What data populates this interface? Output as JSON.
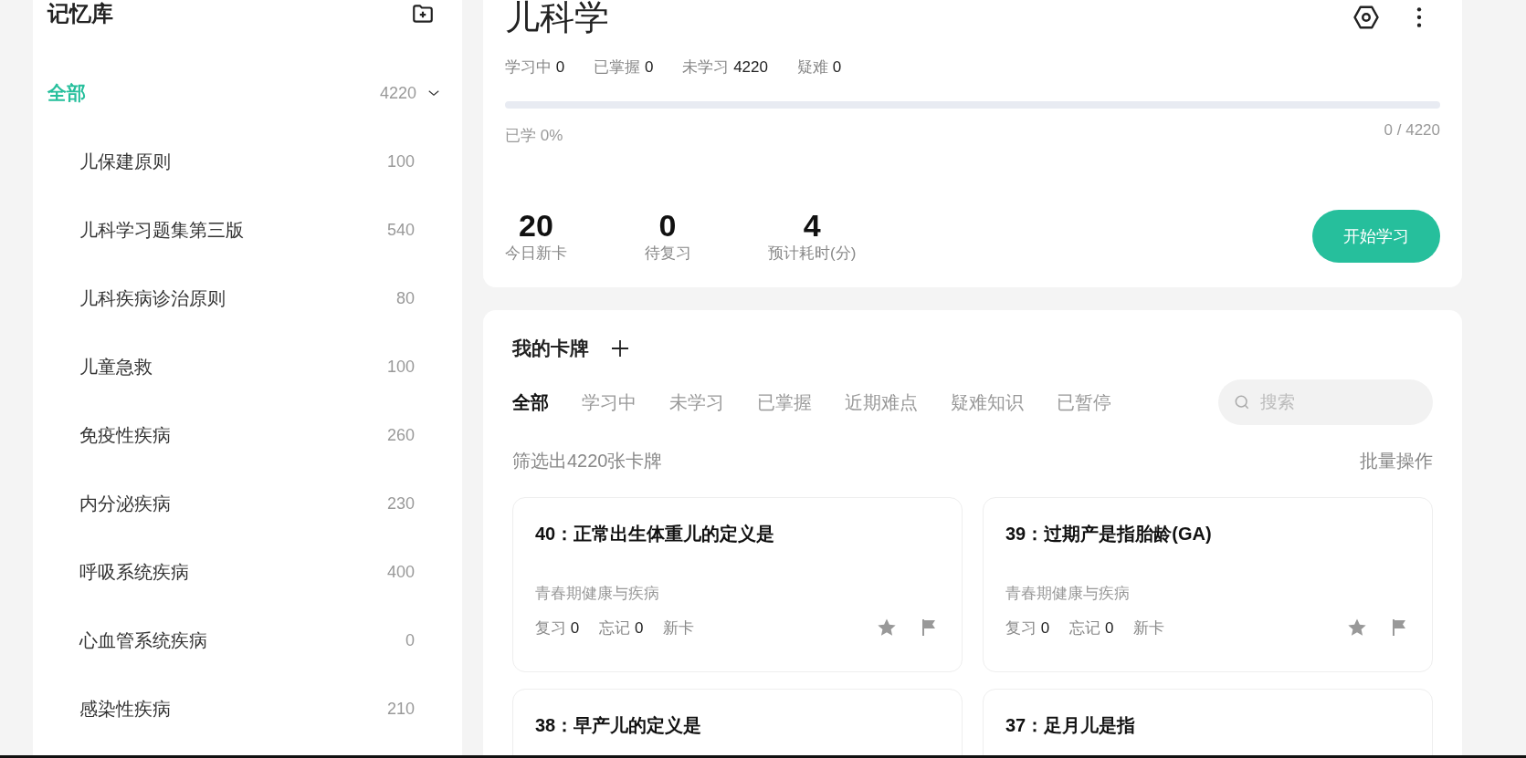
{
  "sidebar": {
    "title": "记忆库",
    "root": {
      "label": "全部",
      "count": "4220",
      "selected": true,
      "expanded": true
    },
    "items": [
      {
        "label": "儿保建原则",
        "count": "100",
        "selected": false
      },
      {
        "label": "儿科学习题集第三版",
        "count": "540",
        "selected": false
      },
      {
        "label": "儿科疾病诊治原则",
        "count": "80",
        "selected": false
      },
      {
        "label": "儿童急救",
        "count": "100",
        "selected": false
      },
      {
        "label": "免疫性疾病",
        "count": "260",
        "selected": false
      },
      {
        "label": "内分泌疾病",
        "count": "230",
        "selected": false
      },
      {
        "label": "呼吸系统疾病",
        "count": "400",
        "selected": false
      },
      {
        "label": "心血管系统疾病",
        "count": "0",
        "selected": false
      },
      {
        "label": "感染性疾病",
        "count": "210",
        "selected": false
      }
    ]
  },
  "deck": {
    "title": "儿科学",
    "stats": [
      {
        "label": "学习中",
        "value": "0"
      },
      {
        "label": "已掌握",
        "value": "0"
      },
      {
        "label": "未学习",
        "value": "4220"
      },
      {
        "label": "疑难",
        "value": "0"
      }
    ],
    "progress": {
      "level": 0,
      "label": "已学 0%",
      "reading": "0 / 4220"
    },
    "summary": [
      {
        "value": "20",
        "label": "今日新卡"
      },
      {
        "value": "0",
        "label": "待复习"
      },
      {
        "value": "4",
        "label": "预计耗时(分)"
      }
    ],
    "start_button": "开始学习"
  },
  "cards_panel": {
    "title": "我的卡牌",
    "tabs": [
      {
        "label": "全部",
        "selected": true
      },
      {
        "label": "学习中",
        "selected": false
      },
      {
        "label": "未学习",
        "selected": false
      },
      {
        "label": "已掌握",
        "selected": false
      },
      {
        "label": "近期难点",
        "selected": false
      },
      {
        "label": "疑难知识",
        "selected": false
      },
      {
        "label": "已暂停",
        "selected": false
      }
    ],
    "search": {
      "placeholder": "搜索"
    },
    "filter_text": "筛选出4220张卡牌",
    "batch_action": "批量操作",
    "cards": [
      {
        "title": "40：正常出生体重儿的定义是",
        "category": "青春期健康与疾病",
        "review": {
          "label": "复习",
          "value": "0"
        },
        "forget": {
          "label": "忘记",
          "value": "0"
        },
        "status": "新卡"
      },
      {
        "title": "39：过期产是指胎龄(GA)",
        "category": "青春期健康与疾病",
        "review": {
          "label": "复习",
          "value": "0"
        },
        "forget": {
          "label": "忘记",
          "value": "0"
        },
        "status": "新卡"
      },
      {
        "title": "38：早产儿的定义是"
      },
      {
        "title": "37：足月儿是指"
      }
    ]
  }
}
